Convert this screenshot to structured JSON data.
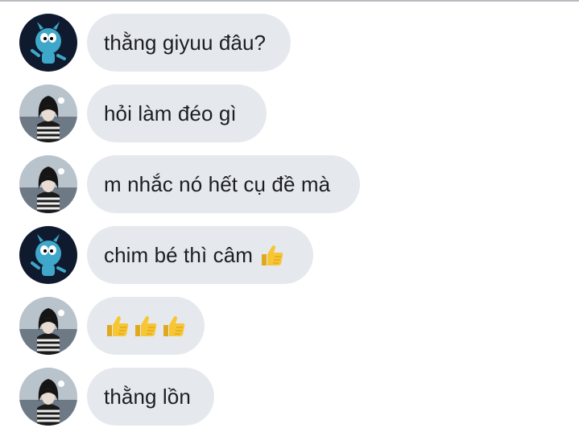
{
  "messages": [
    {
      "sender": "gumball",
      "text": "thằng giyuu đâu?",
      "emoji": []
    },
    {
      "sender": "obanai",
      "text": "hỏi làm đéo gì",
      "emoji": []
    },
    {
      "sender": "obanai",
      "text": "m nhắc nó hết cụ đề mà",
      "emoji": []
    },
    {
      "sender": "gumball",
      "text": "chim bé thì câm",
      "emoji": [
        "thumbs-up-icon"
      ]
    },
    {
      "sender": "obanai",
      "text": "",
      "emoji": [
        "thumbs-up-icon",
        "thumbs-up-icon",
        "thumbs-up-icon"
      ]
    },
    {
      "sender": "obanai",
      "text": "thằng lồn",
      "emoji": []
    }
  ],
  "colors": {
    "bubble": "#e5e9ee",
    "text": "#1c1e21",
    "gumball_bg": "#0f1a2e",
    "gumball_body": "#3fa7c9",
    "obanai_bg": "#b9c3cc",
    "obanai_stripes": "#1a1a1a",
    "thumb": "#f7c634"
  }
}
